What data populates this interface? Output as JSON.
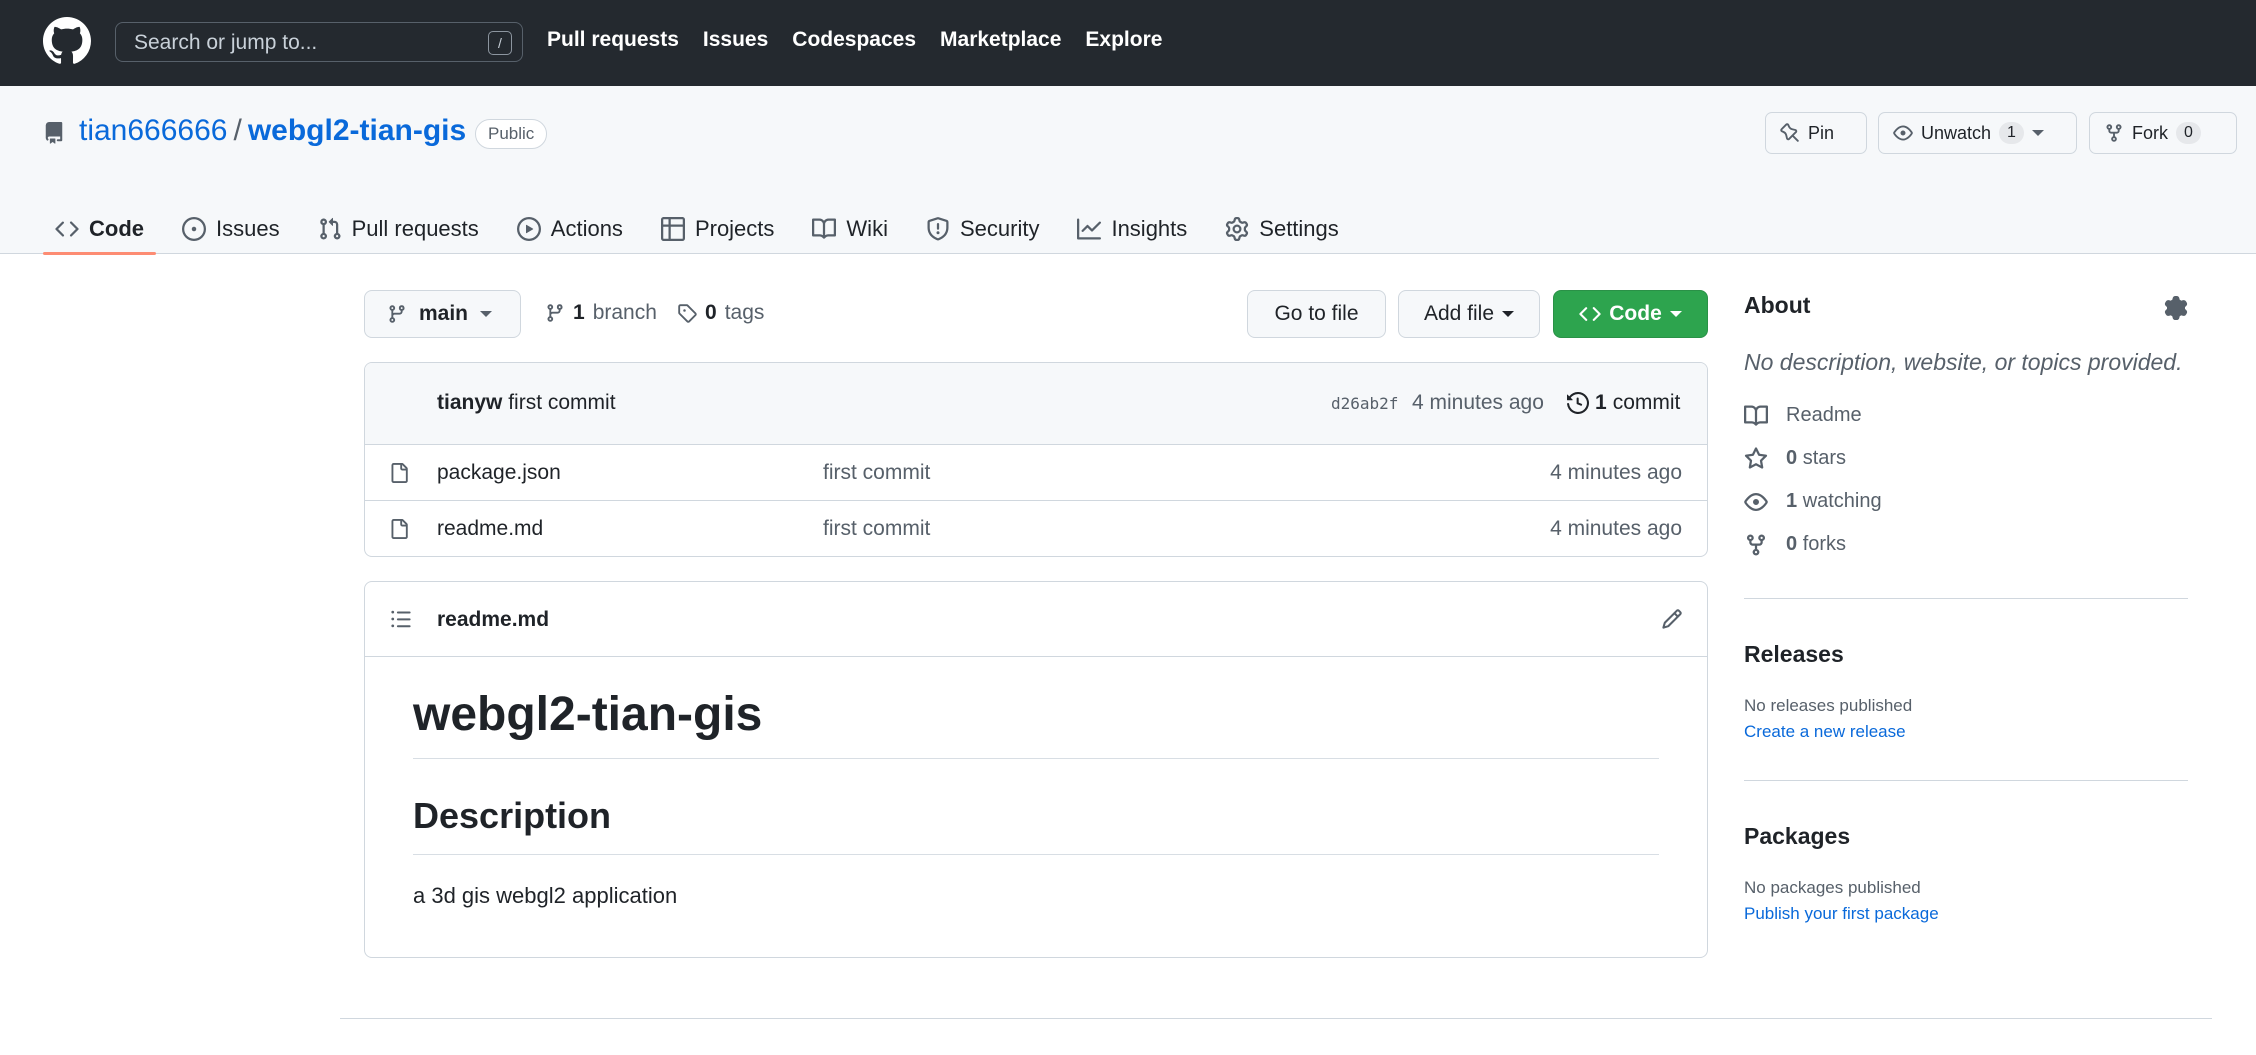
{
  "topbar": {
    "search_placeholder": "Search or jump to...",
    "search_shortcut": "/",
    "nav": [
      "Pull requests",
      "Issues",
      "Codespaces",
      "Marketplace",
      "Explore"
    ]
  },
  "repo": {
    "owner": "tian666666",
    "separator": "/",
    "name": "webgl2-tian-gis",
    "visibility": "Public",
    "pin_label": "Pin",
    "unwatch_label": "Unwatch",
    "watch_count": "1",
    "fork_label": "Fork",
    "fork_count": "0"
  },
  "tabs": [
    {
      "label": "Code",
      "icon": "code-icon",
      "active": true
    },
    {
      "label": "Issues",
      "icon": "issue-icon"
    },
    {
      "label": "Pull requests",
      "icon": "pull-request-icon"
    },
    {
      "label": "Actions",
      "icon": "play-icon"
    },
    {
      "label": "Projects",
      "icon": "table-icon"
    },
    {
      "label": "Wiki",
      "icon": "book-icon"
    },
    {
      "label": "Security",
      "icon": "shield-icon"
    },
    {
      "label": "Insights",
      "icon": "graph-icon"
    },
    {
      "label": "Settings",
      "icon": "gear-icon"
    }
  ],
  "toolbar": {
    "branch": "main",
    "branch_count": "1",
    "branch_label": "branch",
    "tag_count": "0",
    "tag_label": "tags",
    "go_to_file": "Go to file",
    "add_file": "Add file",
    "code": "Code"
  },
  "latest_commit": {
    "author": "tianyw",
    "message": "first commit",
    "hash": "d26ab2f",
    "age": "4 minutes ago",
    "commit_count": "1",
    "commit_label": "commit"
  },
  "files": [
    {
      "name": "package.json",
      "message": "first commit",
      "age": "4 minutes ago"
    },
    {
      "name": "readme.md",
      "message": "first commit",
      "age": "4 minutes ago"
    }
  ],
  "readme": {
    "filename": "readme.md",
    "h1": "webgl2-tian-gis",
    "h2": "Description",
    "text": "a 3d gis webgl2 application"
  },
  "about": {
    "title": "About",
    "description": "No description, website, or topics provided.",
    "readme": "Readme",
    "stars_count": "0",
    "stars_label": "stars",
    "watching_count": "1",
    "watching_label": "watching",
    "forks_count": "0",
    "forks_label": "forks"
  },
  "releases": {
    "title": "Releases",
    "empty": "No releases published",
    "link": "Create a new release"
  },
  "packages": {
    "title": "Packages",
    "empty": "No packages published",
    "link": "Publish your first package"
  },
  "colors": {
    "header_bg": "#24292f",
    "link": "#0969da",
    "green_button": "#2da44e",
    "active_tab_underline": "#fd8c73"
  }
}
